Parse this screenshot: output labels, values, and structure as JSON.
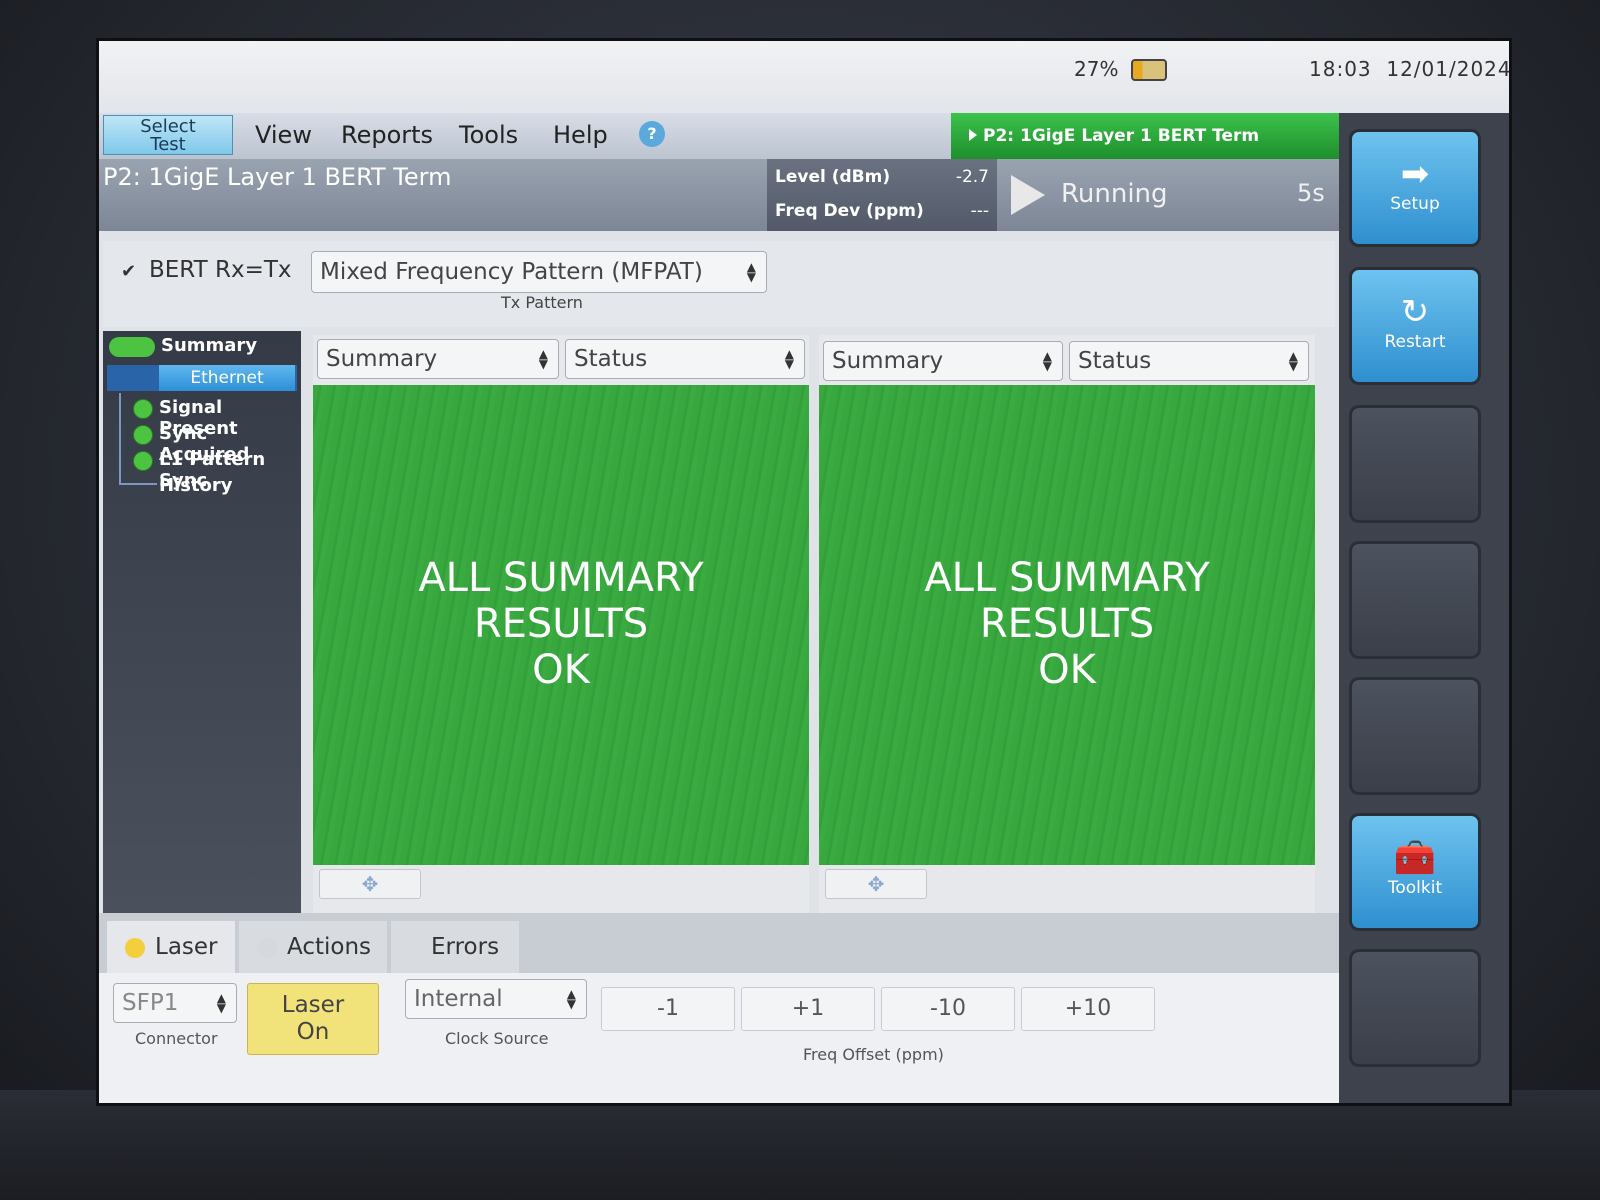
{
  "status": {
    "battery_pct": "27%",
    "time": "18:03",
    "date": "12/01/2024"
  },
  "menu": {
    "select_test_line1": "Select",
    "select_test_line2": "Test",
    "items": [
      "View",
      "Reports",
      "Tools",
      "Help"
    ],
    "active_test_tab": "P2: 1GigE Layer 1 BERT Term"
  },
  "header": {
    "test_title": "P2: 1GigE Layer 1 BERT Term",
    "level_label": "Level (dBm)",
    "level_value": "-2.7",
    "freq_dev_label": "Freq Dev (ppm)",
    "freq_dev_value": "---",
    "run_state": "Running",
    "elapsed": "5s"
  },
  "pattern": {
    "bert_label": "BERT Rx=Tx",
    "checked": true,
    "tx_pattern_value": "Mixed Frequency Pattern (MFPAT)",
    "tx_pattern_label": "Tx Pattern"
  },
  "tree": {
    "summary": "Summary",
    "ethernet": "Ethernet",
    "items": [
      "Signal Present",
      "Sync Acquired",
      "L1 Pattern Sync"
    ],
    "history": "History"
  },
  "panes": [
    {
      "left_select": "Summary",
      "right_select": "Status",
      "line1": "ALL SUMMARY",
      "line2": "RESULTS",
      "line3": "OK"
    },
    {
      "left_select": "Summary",
      "right_select": "Status",
      "line1": "ALL SUMMARY",
      "line2": "RESULTS",
      "line3": "OK"
    }
  ],
  "bottom_tabs": {
    "laser": "Laser",
    "actions": "Actions",
    "errors": "Errors"
  },
  "controls": {
    "connector_value": "SFP1",
    "connector_label": "Connector",
    "laser_line1": "Laser",
    "laser_line2": "On",
    "clock_value": "Internal",
    "clock_label": "Clock Source",
    "freq_buttons": [
      "-1",
      "+1",
      "-10",
      "+10"
    ],
    "freq_label": "Freq Offset (ppm)"
  },
  "softkeys": {
    "setup": "Setup",
    "restart": "Restart",
    "toolkit": "Toolkit"
  },
  "colors": {
    "pass_green": "#37a73e",
    "accent_blue": "#2f8fcf",
    "laser_yellow": "#f2e27a"
  }
}
